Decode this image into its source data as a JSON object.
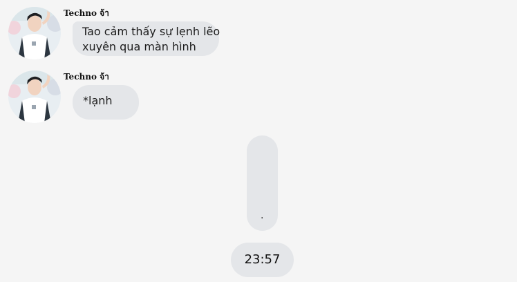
{
  "messages": [
    {
      "sender": "Techno จ้า",
      "text_line1": "Tao cảm thấy sự lẹnh lẽo",
      "text_line2": "xuyên qua màn hình"
    },
    {
      "sender": "Techno จ้า",
      "text": "*lạnh"
    }
  ],
  "outgoing": {
    "text": ".",
    "time": "23:57"
  },
  "colors": {
    "background": "#f5f5f5",
    "bubble": "#e4e6e9"
  }
}
